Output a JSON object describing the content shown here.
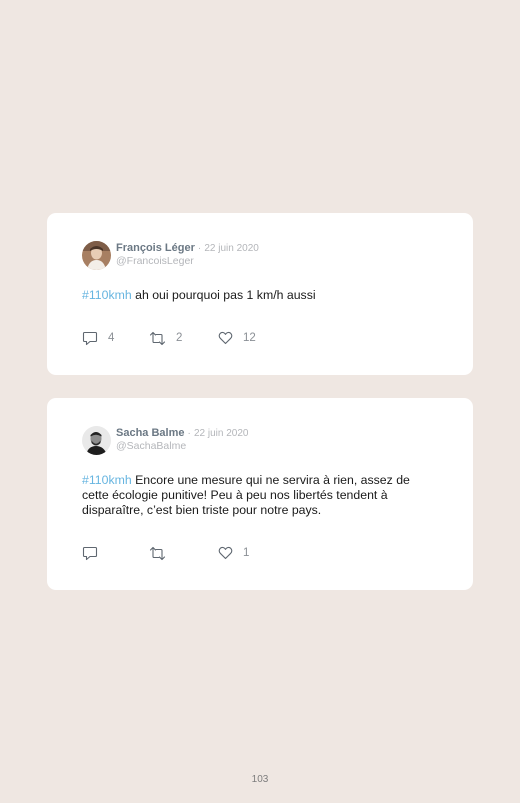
{
  "tweets": [
    {
      "name": "François Léger",
      "separator": "·",
      "date": "22 juin 2020",
      "handle": "@FrancoisLeger",
      "hashtag": "#110kmh",
      "text": " ah oui pourquoi pas 1 km/h aussi",
      "replies": "4",
      "retweets": "2",
      "likes": "12"
    },
    {
      "name": "Sacha Balme",
      "separator": "·",
      "date": "22 juin 2020",
      "handle": "@SachaBalme",
      "hashtag": "#110kmh",
      "text": " Encore une mesure qui ne servira à rien, assez de cette écologie punitive! Peu à peu nos libertés tendent à disparaître, c’est bien triste pour notre pays.",
      "replies": "",
      "retweets": "",
      "likes": "1"
    }
  ],
  "page_number": "103",
  "colors": {
    "background": "#efe7e2",
    "card": "#ffffff",
    "hashtag": "#67b5e0",
    "name": "#6b7884",
    "muted": "#b4b6ba"
  },
  "icons": [
    "reply-icon",
    "retweet-icon",
    "like-icon"
  ]
}
